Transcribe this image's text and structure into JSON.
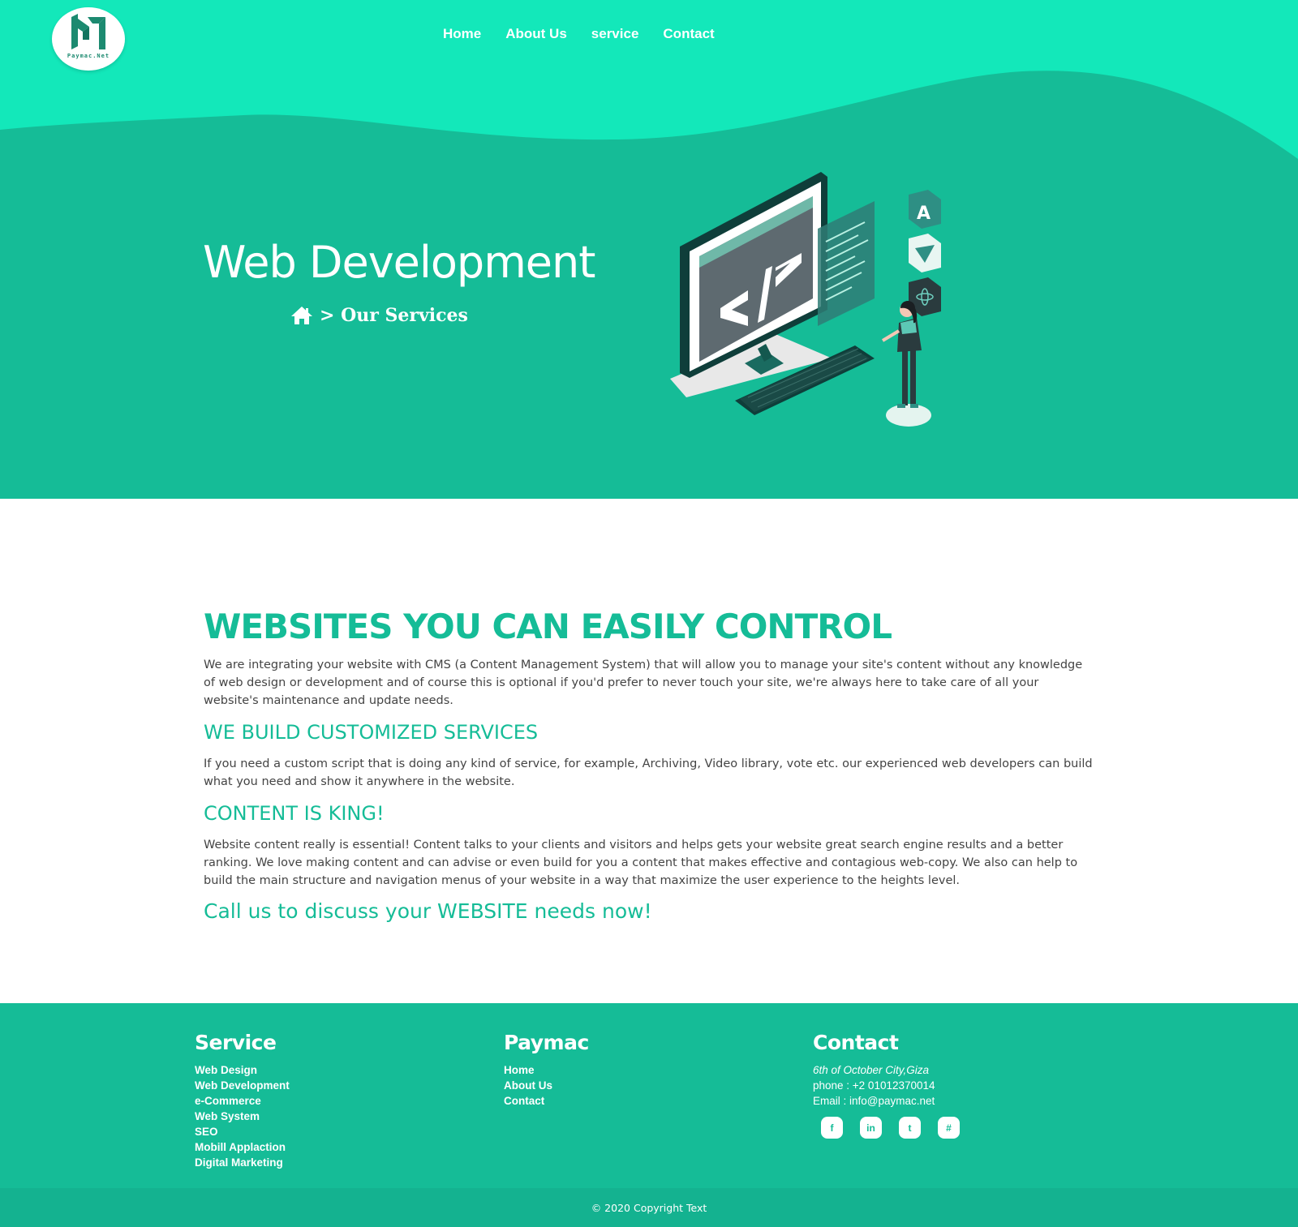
{
  "brand": {
    "logo_text": "Paymac.Net"
  },
  "nav": {
    "items": [
      "Home",
      "About Us",
      "service",
      "Contact"
    ]
  },
  "hero": {
    "title": "Web Development",
    "breadcrumb_current": "> Our Services"
  },
  "content": {
    "heading": "WEBSITES YOU CAN EASILY CONTROL",
    "intro": "We are integrating your website with CMS (a Content Management System) that will allow you to manage your site's content without any knowledge of web design or development and of course this is optional if you'd prefer to never touch your site, we're always here to take care of all your website's maintenance and update needs.",
    "section1_title": "WE BUILD CUSTOMIZED SERVICES",
    "section1_text": "If you need a custom script that is doing any kind of service, for example, Archiving, Video library, vote etc. our experienced web developers can build what you need and show it anywhere in the website.",
    "section2_title": "CONTENT IS KING!",
    "section2_text": "Website content really is essential! Content talks to your clients and visitors and helps gets your website great search engine results and a better ranking. We love making content and can advise or even build for you a content that makes effective and contagious web-copy. We also can help to build the main structure and navigation menus of your website in a way that maximize the user experience to the heights level.",
    "cta": "Call us to discuss your WEBSITE needs now!"
  },
  "footer": {
    "service": {
      "title": "Service",
      "items": [
        "Web Design",
        "Web Development",
        "e-Commerce",
        "Web System",
        "SEO",
        "Mobill Applaction",
        "Digital Marketing"
      ]
    },
    "paymac": {
      "title": "Paymac",
      "items": [
        "Home",
        "About Us",
        "Contact"
      ]
    },
    "contact": {
      "title": "Contact",
      "address": "6th of October City,Giza",
      "phone": "phone : +2 01012370014",
      "email": "Email : info@paymac.net",
      "social_icons": [
        "facebook-icon",
        "linkedin-icon",
        "twitter-icon",
        "slack-icon"
      ],
      "social_glyphs": [
        "f",
        "in",
        "t",
        "#"
      ]
    },
    "copyright": "© 2020 Copyright Text"
  },
  "colors": {
    "primary": "#15bc97",
    "header_wave": "#13e8ba",
    "text": "#444444",
    "white": "#ffffff"
  }
}
